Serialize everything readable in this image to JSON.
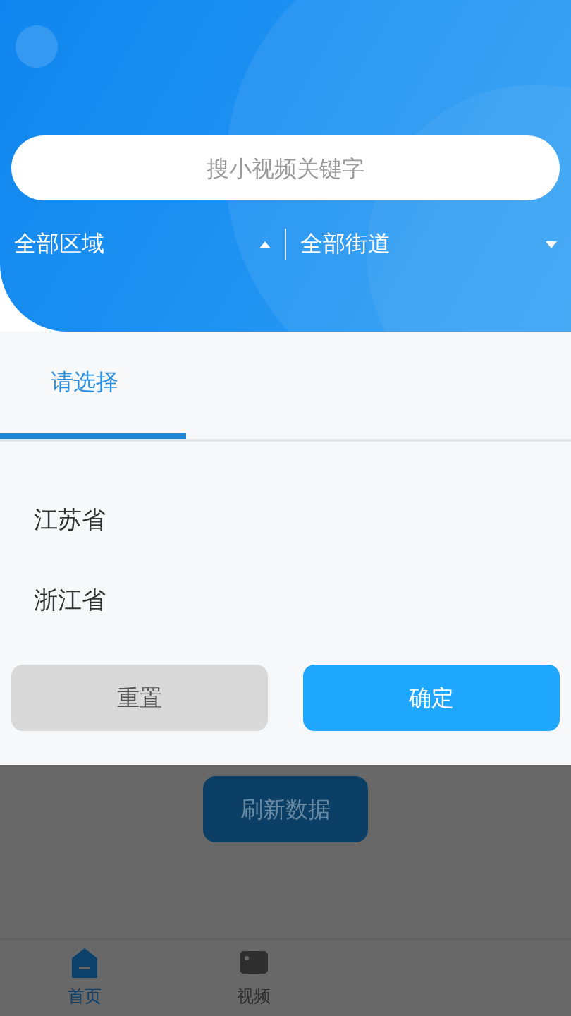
{
  "search": {
    "placeholder": "搜小视频关键字"
  },
  "filters": [
    {
      "label": "全部区域",
      "expanded": true
    },
    {
      "label": "全部街道",
      "expanded": false
    }
  ],
  "picker": {
    "tabs": [
      {
        "label": "请选择",
        "selected": true
      }
    ],
    "options": [
      "江苏省",
      "浙江省"
    ],
    "buttons": [
      {
        "label": "重置",
        "kind": "secondary"
      },
      {
        "label": "确定",
        "kind": "primary"
      }
    ]
  },
  "page": {
    "refresh_button": "刷新数据"
  },
  "tab_bar": [
    {
      "label": "首页",
      "selected": true,
      "kind": "home"
    },
    {
      "label": "视频",
      "selected": false,
      "kind": "video"
    }
  ]
}
